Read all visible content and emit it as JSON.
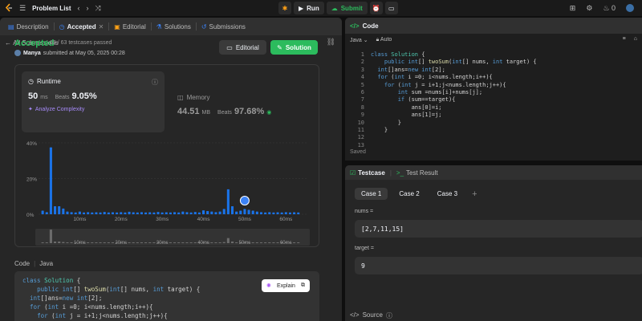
{
  "topbar": {
    "title": "Problem List",
    "run_label": "Run",
    "submit_label": "Submit",
    "points": "0"
  },
  "left_tabs": [
    {
      "label": "Description"
    },
    {
      "label": "Accepted"
    },
    {
      "label": "Editorial"
    },
    {
      "label": "Solutions"
    },
    {
      "label": "Submissions"
    }
  ],
  "subheader": {
    "back_label": "All Submissions"
  },
  "result": {
    "status": "Accepted",
    "passed": "63 / 63 testcases passed",
    "user": "Manya",
    "submitted_text": "submitted at May 05, 2025 00:28",
    "editorial_label": "Editorial",
    "solution_label": "Solution"
  },
  "runtime": {
    "title": "Runtime",
    "value": "50",
    "unit": "ms",
    "beats_label": "Beats",
    "beats": "9.05%",
    "analyze_label": "Analyze Complexity"
  },
  "memory": {
    "title": "Memory",
    "value": "44.51",
    "unit": "MB",
    "beats_label": "Beats",
    "beats": "97.68%"
  },
  "chart_data": {
    "type": "bar",
    "y_ticks": [
      "40%",
      "20%",
      "0%"
    ],
    "ylim": [
      0,
      40
    ],
    "x_ticks": [
      "10ms",
      "20ms",
      "30ms",
      "40ms",
      "50ms",
      "60ms"
    ],
    "xlim": [
      0,
      65
    ],
    "x_tick_values": [
      10,
      20,
      30,
      40,
      50,
      60
    ],
    "user_value_ms": 50,
    "accent": "#1a73e8",
    "bars": [
      {
        "x": 1,
        "y": 2.0
      },
      {
        "x": 2,
        "y": 1.2
      },
      {
        "x": 3,
        "y": 37.5
      },
      {
        "x": 4,
        "y": 4.5
      },
      {
        "x": 5,
        "y": 4.5
      },
      {
        "x": 6,
        "y": 3.2
      },
      {
        "x": 7,
        "y": 1.5
      },
      {
        "x": 8,
        "y": 1.2
      },
      {
        "x": 9,
        "y": 1.0
      },
      {
        "x": 10,
        "y": 1.5
      },
      {
        "x": 11,
        "y": 1.0
      },
      {
        "x": 12,
        "y": 1.2
      },
      {
        "x": 13,
        "y": 1.0
      },
      {
        "x": 14,
        "y": 1.1
      },
      {
        "x": 15,
        "y": 1.0
      },
      {
        "x": 16,
        "y": 1.3
      },
      {
        "x": 17,
        "y": 1.0
      },
      {
        "x": 18,
        "y": 1.1
      },
      {
        "x": 19,
        "y": 1.0
      },
      {
        "x": 20,
        "y": 1.2
      },
      {
        "x": 21,
        "y": 1.0
      },
      {
        "x": 22,
        "y": 1.4
      },
      {
        "x": 23,
        "y": 1.1
      },
      {
        "x": 24,
        "y": 1.0
      },
      {
        "x": 25,
        "y": 1.2
      },
      {
        "x": 26,
        "y": 1.0
      },
      {
        "x": 27,
        "y": 1.1
      },
      {
        "x": 28,
        "y": 1.0
      },
      {
        "x": 29,
        "y": 1.3
      },
      {
        "x": 30,
        "y": 1.0
      },
      {
        "x": 31,
        "y": 1.1
      },
      {
        "x": 32,
        "y": 1.0
      },
      {
        "x": 33,
        "y": 1.2
      },
      {
        "x": 34,
        "y": 1.0
      },
      {
        "x": 35,
        "y": 1.5
      },
      {
        "x": 36,
        "y": 1.2
      },
      {
        "x": 37,
        "y": 1.0
      },
      {
        "x": 38,
        "y": 1.3
      },
      {
        "x": 39,
        "y": 1.0
      },
      {
        "x": 40,
        "y": 2.2
      },
      {
        "x": 41,
        "y": 1.8
      },
      {
        "x": 42,
        "y": 1.5
      },
      {
        "x": 43,
        "y": 1.2
      },
      {
        "x": 44,
        "y": 1.5
      },
      {
        "x": 45,
        "y": 3.0
      },
      {
        "x": 46,
        "y": 14.0
      },
      {
        "x": 47,
        "y": 4.5
      },
      {
        "x": 48,
        "y": 1.5
      },
      {
        "x": 49,
        "y": 2.0
      },
      {
        "x": 50,
        "y": 3.0
      },
      {
        "x": 51,
        "y": 2.5
      },
      {
        "x": 52,
        "y": 2.0
      },
      {
        "x": 53,
        "y": 1.5
      },
      {
        "x": 54,
        "y": 1.2
      },
      {
        "x": 55,
        "y": 1.0
      },
      {
        "x": 56,
        "y": 1.2
      },
      {
        "x": 57,
        "y": 1.0
      },
      {
        "x": 58,
        "y": 1.1
      },
      {
        "x": 59,
        "y": 1.0
      },
      {
        "x": 60,
        "y": 1.2
      },
      {
        "x": 61,
        "y": 1.0
      },
      {
        "x": 62,
        "y": 1.1
      },
      {
        "x": 63,
        "y": 1.0
      }
    ]
  },
  "submitted_code": {
    "label": "Code",
    "lang": "Java",
    "explain_label": "Explain",
    "lines": [
      "class Solution {",
      "    public int[] twoSum(int[] nums, int target) {",
      "  int[]ans=new int[2];",
      "  for (int i =0; i<nums.length;i++){",
      "    for (int j = i+1;j<nums.length;j++){"
    ]
  },
  "editor": {
    "title": "Code",
    "lang": "Java",
    "mode": "Auto",
    "saved": "Saved",
    "line_numbers": [
      "1",
      "2",
      "3",
      "4",
      "5",
      "6",
      "7",
      "8",
      "9",
      "10",
      "11",
      "12",
      "13"
    ],
    "lines": [
      "class Solution {",
      "    public int[] twoSum(int[] nums, int target) {",
      "  int[]ans=new int[2];",
      "  for (int i =0; i<nums.length;i++){",
      "    for (int j = i+1;j<nums.length;j++){",
      "        int sum =nums[i]+nums[j];",
      "        if (sum==target){",
      "            ans[0]=i;",
      "            ans[1]=j;",
      "        }",
      "    }",
      "",
      ""
    ]
  },
  "testcase": {
    "tab_label": "Testcase",
    "result_label": "Test Result",
    "cases": [
      "Case 1",
      "Case 2",
      "Case 3"
    ],
    "nums_label": "nums =",
    "nums_value": "[2,7,11,15]",
    "target_label": "target =",
    "target_value": "9",
    "source_label": "Source"
  }
}
